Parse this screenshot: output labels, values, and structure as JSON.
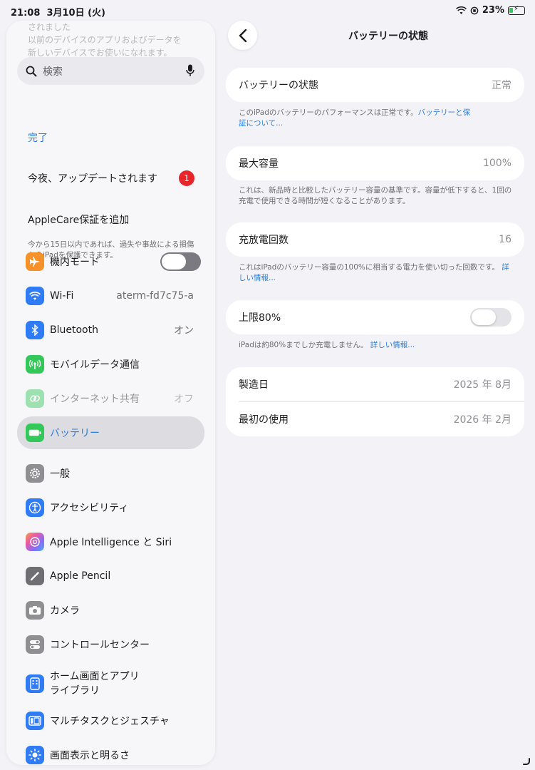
{
  "status": {
    "time": "21:08",
    "date": "3月10日 (火)",
    "battery_percent": "23%"
  },
  "sidebar": {
    "faded_top_1": "されました",
    "faded_top_2": "以前のデバイスのアプリおよびデータを",
    "faded_top_3": "新しいデバイスでお使いになれます。",
    "search_placeholder": "検索",
    "done_label": "完了",
    "update_label": "今夜、アップデートされます",
    "update_badge": "1",
    "applecare_label": "AppleCare保証を追加",
    "applecare_desc": "今から15日以内であれば、過失や事故による損傷からiPadを保護できます。",
    "items": [
      {
        "label": "機内モード",
        "icon": "airplane-icon",
        "color": "#f7922a",
        "value": ""
      },
      {
        "label": "Wi-Fi",
        "icon": "wifi-icon",
        "color": "#2f7cf6",
        "value": "aterm-fd7c75-a"
      },
      {
        "label": "Bluetooth",
        "icon": "bluetooth-icon",
        "color": "#2f7cf6",
        "value": "オン"
      },
      {
        "label": "モバイルデータ通信",
        "icon": "antenna-icon",
        "color": "#34c759",
        "value": ""
      },
      {
        "label": "インターネット共有",
        "icon": "link-icon",
        "color": "#34c759",
        "value": "オフ"
      },
      {
        "label": "バッテリー",
        "icon": "battery-icon",
        "color": "#34c759",
        "value": ""
      },
      {
        "label": "一般",
        "icon": "gear-icon",
        "color": "#8e8e93",
        "value": ""
      },
      {
        "label": "アクセシビリティ",
        "icon": "accessibility-icon",
        "color": "#2f7cf6",
        "value": ""
      },
      {
        "label": "Apple Intelligence と Siri",
        "icon": "siri-icon",
        "color": "#c86df1",
        "value": ""
      },
      {
        "label": "Apple Pencil",
        "icon": "pencil-icon",
        "color": "#6e6e73",
        "value": ""
      },
      {
        "label": "カメラ",
        "icon": "camera-icon",
        "color": "#8e8e93",
        "value": ""
      },
      {
        "label": "コントロールセンター",
        "icon": "switches-icon",
        "color": "#8e8e93",
        "value": ""
      },
      {
        "label": "ホーム画面とアプリ",
        "label2": "ライブラリ",
        "icon": "home-grid-icon",
        "color": "#2f7cf6",
        "value": ""
      },
      {
        "label": "マルチタスクとジェスチャ",
        "icon": "multitask-icon",
        "color": "#2f7cf6",
        "value": ""
      },
      {
        "label": "画面表示と明るさ",
        "icon": "sun-icon",
        "color": "#2f7cf6",
        "value": ""
      }
    ]
  },
  "main": {
    "title": "バッテリーの状態",
    "health_label": "バッテリーの状態",
    "health_value": "正常",
    "health_foot": "このiPadのバッテリーのパフォーマンスは正常です。",
    "health_foot_link_1": "バッテリーと保",
    "health_foot_link_2": "証について...",
    "capacity_label": "最大容量",
    "capacity_value": "100%",
    "capacity_foot": "これは、新品時と比較したバッテリー容量の基準です。容量が低下すると、1回の充電で使用できる時間が短くなることがあります。",
    "cycle_label": "充放電回数",
    "cycle_value": "16",
    "cycle_foot_1": "これはiPadのバッテリー容量の100%に相当する電力を使い切った回数です。",
    "cycle_foot_link": "詳しい情報...",
    "limit_label": "上限80%",
    "limit_foot": "iPadは約80%までしか充電しません。",
    "limit_foot_link": "詳しい情報...",
    "manufacture_label": "製造日",
    "manufacture_value": "2025 年 8月",
    "first_use_label": "最初の使用",
    "first_use_value": "2026 年 2月"
  }
}
